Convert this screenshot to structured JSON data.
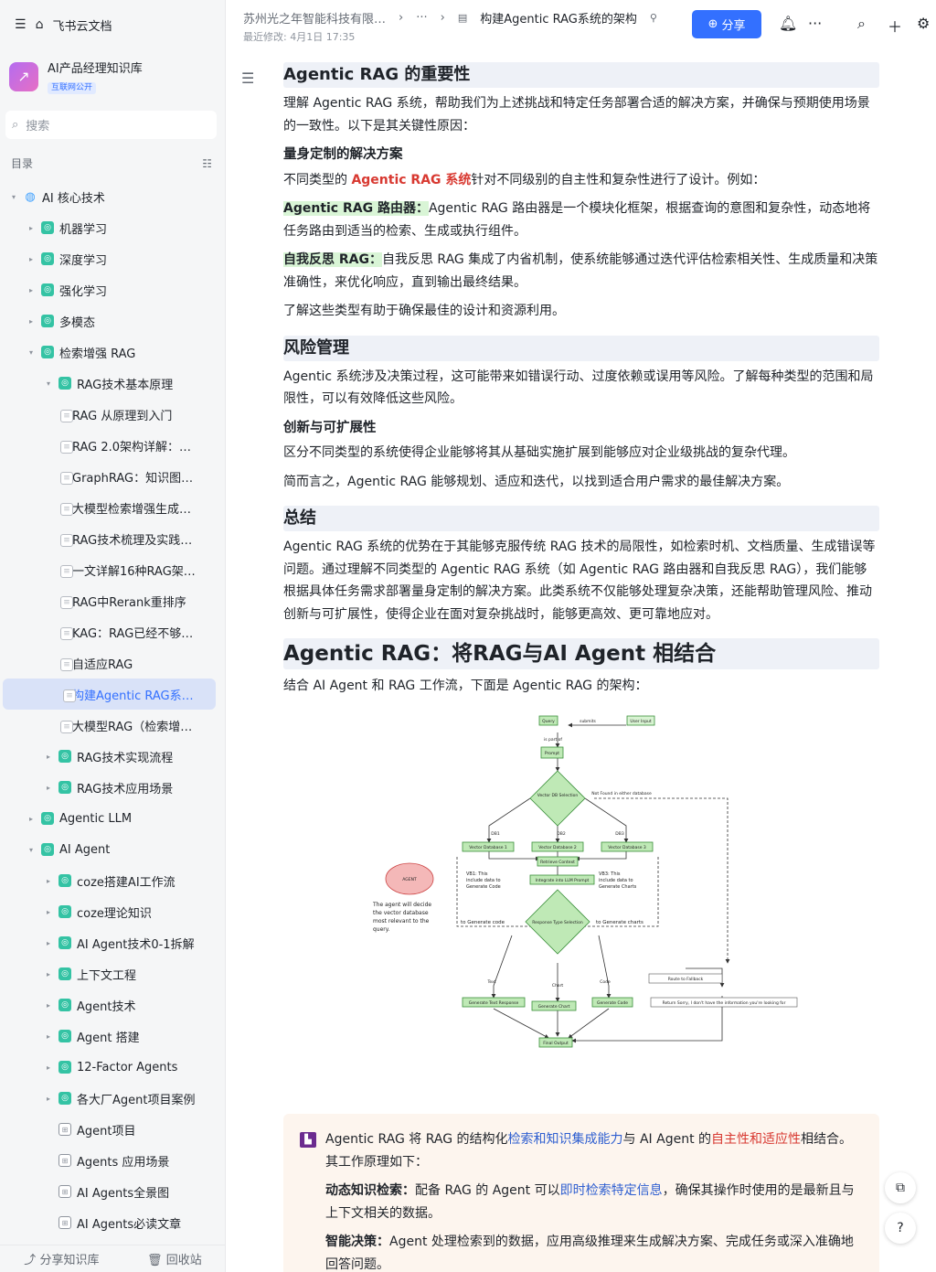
{
  "sidebar": {
    "app_name": "飞书云文档",
    "kb_name": "AI产品经理知识库",
    "kb_tag": "互联网公开",
    "search_placeholder": "搜索",
    "toc_label": "目录",
    "tree": [
      {
        "level": 0,
        "arrow": "▾",
        "icon": "globe",
        "label": "AI 核心技术"
      },
      {
        "level": 1,
        "arrow": "▸",
        "icon": "g",
        "label": "机器学习"
      },
      {
        "level": 1,
        "arrow": "▸",
        "icon": "g",
        "label": "深度学习"
      },
      {
        "level": 1,
        "arrow": "▸",
        "icon": "g",
        "label": "强化学习"
      },
      {
        "level": 1,
        "arrow": "▸",
        "icon": "g",
        "label": "多模态"
      },
      {
        "level": 1,
        "arrow": "▾",
        "icon": "g",
        "label": "检索增强 RAG"
      },
      {
        "level": 2,
        "arrow": "▾",
        "icon": "g",
        "label": "RAG技术基本原理"
      },
      {
        "level": 3,
        "arrow": "",
        "icon": "doc",
        "label": "RAG 从原理到入门"
      },
      {
        "level": 3,
        "arrow": "",
        "icon": "doc",
        "label": "RAG 2.0架构详解：…"
      },
      {
        "level": 3,
        "arrow": "",
        "icon": "doc",
        "label": "GraphRAG：知识图…"
      },
      {
        "level": 3,
        "arrow": "",
        "icon": "doc",
        "label": "大模型检索增强生成…"
      },
      {
        "level": 3,
        "arrow": "",
        "icon": "doc",
        "label": "RAG技术梳理及实践…"
      },
      {
        "level": 3,
        "arrow": "",
        "icon": "doc",
        "label": "一文详解16种RAG架…"
      },
      {
        "level": 3,
        "arrow": "",
        "icon": "doc",
        "label": "RAG中Rerank重排序"
      },
      {
        "level": 3,
        "arrow": "",
        "icon": "doc",
        "label": "KAG：RAG已经不够…"
      },
      {
        "level": 3,
        "arrow": "",
        "icon": "doc",
        "label": "自适应RAG"
      },
      {
        "level": 3,
        "arrow": "",
        "icon": "doc",
        "label": "构建Agentic RAG系…",
        "selected": true
      },
      {
        "level": 3,
        "arrow": "",
        "icon": "doc",
        "label": "大模型RAG（检索增…"
      },
      {
        "level": 2,
        "arrow": "▸",
        "icon": "g",
        "label": "RAG技术实现流程"
      },
      {
        "level": 2,
        "arrow": "▸",
        "icon": "g",
        "label": "RAG技术应用场景"
      },
      {
        "level": 1,
        "arrow": "▸",
        "icon": "g",
        "label": "Agentic LLM"
      },
      {
        "level": 1,
        "arrow": "▾",
        "icon": "g",
        "label": "AI Agent"
      },
      {
        "level": 2,
        "arrow": "▸",
        "icon": "g",
        "label": "coze搭建AI工作流"
      },
      {
        "level": 2,
        "arrow": "▸",
        "icon": "g",
        "label": "coze理论知识"
      },
      {
        "level": 2,
        "arrow": "▸",
        "icon": "g",
        "label": "AI Agent技术0-1拆解"
      },
      {
        "level": 2,
        "arrow": "▸",
        "icon": "g",
        "label": "上下文工程"
      },
      {
        "level": 2,
        "arrow": "▸",
        "icon": "g",
        "label": "Agent技术"
      },
      {
        "level": 2,
        "arrow": "▸",
        "icon": "g",
        "label": "Agent 搭建"
      },
      {
        "level": 2,
        "arrow": "▸",
        "icon": "g",
        "label": "12-Factor Agents"
      },
      {
        "level": 2,
        "arrow": "▸",
        "icon": "g",
        "label": "各大厂Agent项目案例"
      },
      {
        "level": 2,
        "arrow": "",
        "icon": "box",
        "label": "Agent项目"
      },
      {
        "level": 2,
        "arrow": "",
        "icon": "box",
        "label": "Agents 应用场景"
      },
      {
        "level": 2,
        "arrow": "",
        "icon": "box",
        "label": "AI Agents全景图"
      },
      {
        "level": 2,
        "arrow": "",
        "icon": "box",
        "label": "AI Agents必读文章"
      }
    ],
    "share_kb": "分享知识库",
    "recycle": "回收站"
  },
  "header": {
    "breadcrumb_root": "苏州光之年智能科技有限…",
    "breadcrumb_more": "···",
    "doc_title": "构建Agentic RAG系统的架构",
    "modified": "最近修改: 4月1日 17:35",
    "share_label": "分享"
  },
  "doc": {
    "s1_title": "Agentic RAG 的重要性",
    "s1_p1": "理解 Agentic RAG 系统，帮助我们为上述挑战和特定任务部署合适的解决方案，并确保与预期使用场景的一致性。以下是其关键性原因：",
    "s1_h3": "量身定制的解决方案",
    "s1_p2a": "不同类型的 ",
    "s1_p2b": "Agentic RAG 系统",
    "s1_p2c": "针对不同级别的自主性和复杂性进行了设计。例如：",
    "router_label": "Agentic RAG 路由器：",
    "router_text": "Agentic RAG 路由器是一个模块化框架，根据查询的意图和复杂性，动态地将任务路由到适当的检索、生成或执行组件。",
    "selfrag_label": "自我反思 RAG：",
    "selfrag_text": "自我反思 RAG 集成了内省机制，使系统能够通过迭代评估检索相关性、生成质量和决策准确性，来优化响应，直到输出最终结果。",
    "s1_p3": "了解这些类型有助于确保最佳的设计和资源利用。",
    "s2_title": "风险管理",
    "s2_p1": "Agentic 系统涉及决策过程，这可能带来如错误行动、过度依赖或误用等风险。了解每种类型的范围和局限性，可以有效降低这些风险。",
    "s2_h3": "创新与可扩展性",
    "s2_p2": "区分不同类型的系统使得企业能够将其从基础实施扩展到能够应对企业级挑战的复杂代理。",
    "s2_p3": "简而言之，Agentic RAG 能够规划、适应和迭代，以找到适合用户需求的最佳解决方案。",
    "s3_title": "总结",
    "s3_p1": "Agentic RAG 系统的优势在于其能够克服传统 RAG 技术的局限性，如检索时机、文档质量、生成错误等问题。通过理解不同类型的 Agentic RAG 系统（如 Agentic RAG 路由器和自我反思 RAG），我们能够根据具体任务需求部署量身定制的解决方案。此类系统不仅能够处理复杂决策，还能帮助管理风险、推动创新与可扩展性，使得企业在面对复杂挑战时，能够更高效、更可靠地应对。",
    "h1_title": "Agentic RAG：将RAG与AI Agent 相结合",
    "h1_p1": "结合 AI Agent 和 RAG 工作流，下面是 Agentic RAG 的架构：",
    "flow": {
      "query": "Query",
      "submits": "submits",
      "user": "User Input",
      "part_of": "is part of",
      "prompt": "Prompt",
      "selection": "Vector DB Selection",
      "not_found": "Not Found in either database",
      "db1": "Vector Database 1",
      "db2": "Vector Database 2",
      "db3": "Vector Database 3",
      "n1": "DB1",
      "n2": "DB2",
      "n3": "DB3",
      "retrieve": "Retrieve Context",
      "integrate": "Integrate into LLM Prompt",
      "agent": "AGENT",
      "agent_note1": "The agent will decide",
      "agent_note2": "the vector database",
      "agent_note3": "most relevant to the",
      "agent_note4": "query.",
      "via1_1": "VB1: This",
      "via1_2": "include data to",
      "via1_3": "Generate Code",
      "via3_1": "VB3: This",
      "via3_2": "include data to",
      "via3_3": "Generate Charts",
      "to_code": "to Generate code",
      "to_charts": "to Generate charts",
      "resp_type": "Response Type Selection",
      "text": "Text",
      "chart": "Chart",
      "code": "Code",
      "gen_text": "Generate Text Response",
      "gen_chart": "Generate Chart",
      "gen_code": "Generate Code",
      "route": "Route to Fallback",
      "sorry": "Return Sorry, I don't have the information you're looking for",
      "final": "Final Output"
    },
    "callout_p1a": "Agentic RAG 将 RAG 的结构化",
    "callout_p1b": "检索和知识集成能力",
    "callout_p1c": "与 AI Agent 的",
    "callout_p1d": "自主性和适应性",
    "callout_p1e": "相结合。其工作原理如下：",
    "callout_l1a": "动态知识检索：",
    "callout_l1b": "配备 RAG 的 Agent 可以",
    "callout_l1c": "即时检索特定信息",
    "callout_l1d": "，确保其操作时使用的是最新且与上下文相关的数据。",
    "callout_l2a": "智能决策：",
    "callout_l2b": "Agent 处理检索到的数据，应用高级推理来生成解决方案、完成任务或深入准确地回答问题。"
  },
  "colors": {
    "accent": "#3370ff",
    "highlight": "#d9f5d6",
    "keyword_red": "#d83931",
    "section_bg": "#eef1f7",
    "flow_green": "#bfe9b6",
    "flow_stroke": "#3a8f3a"
  }
}
